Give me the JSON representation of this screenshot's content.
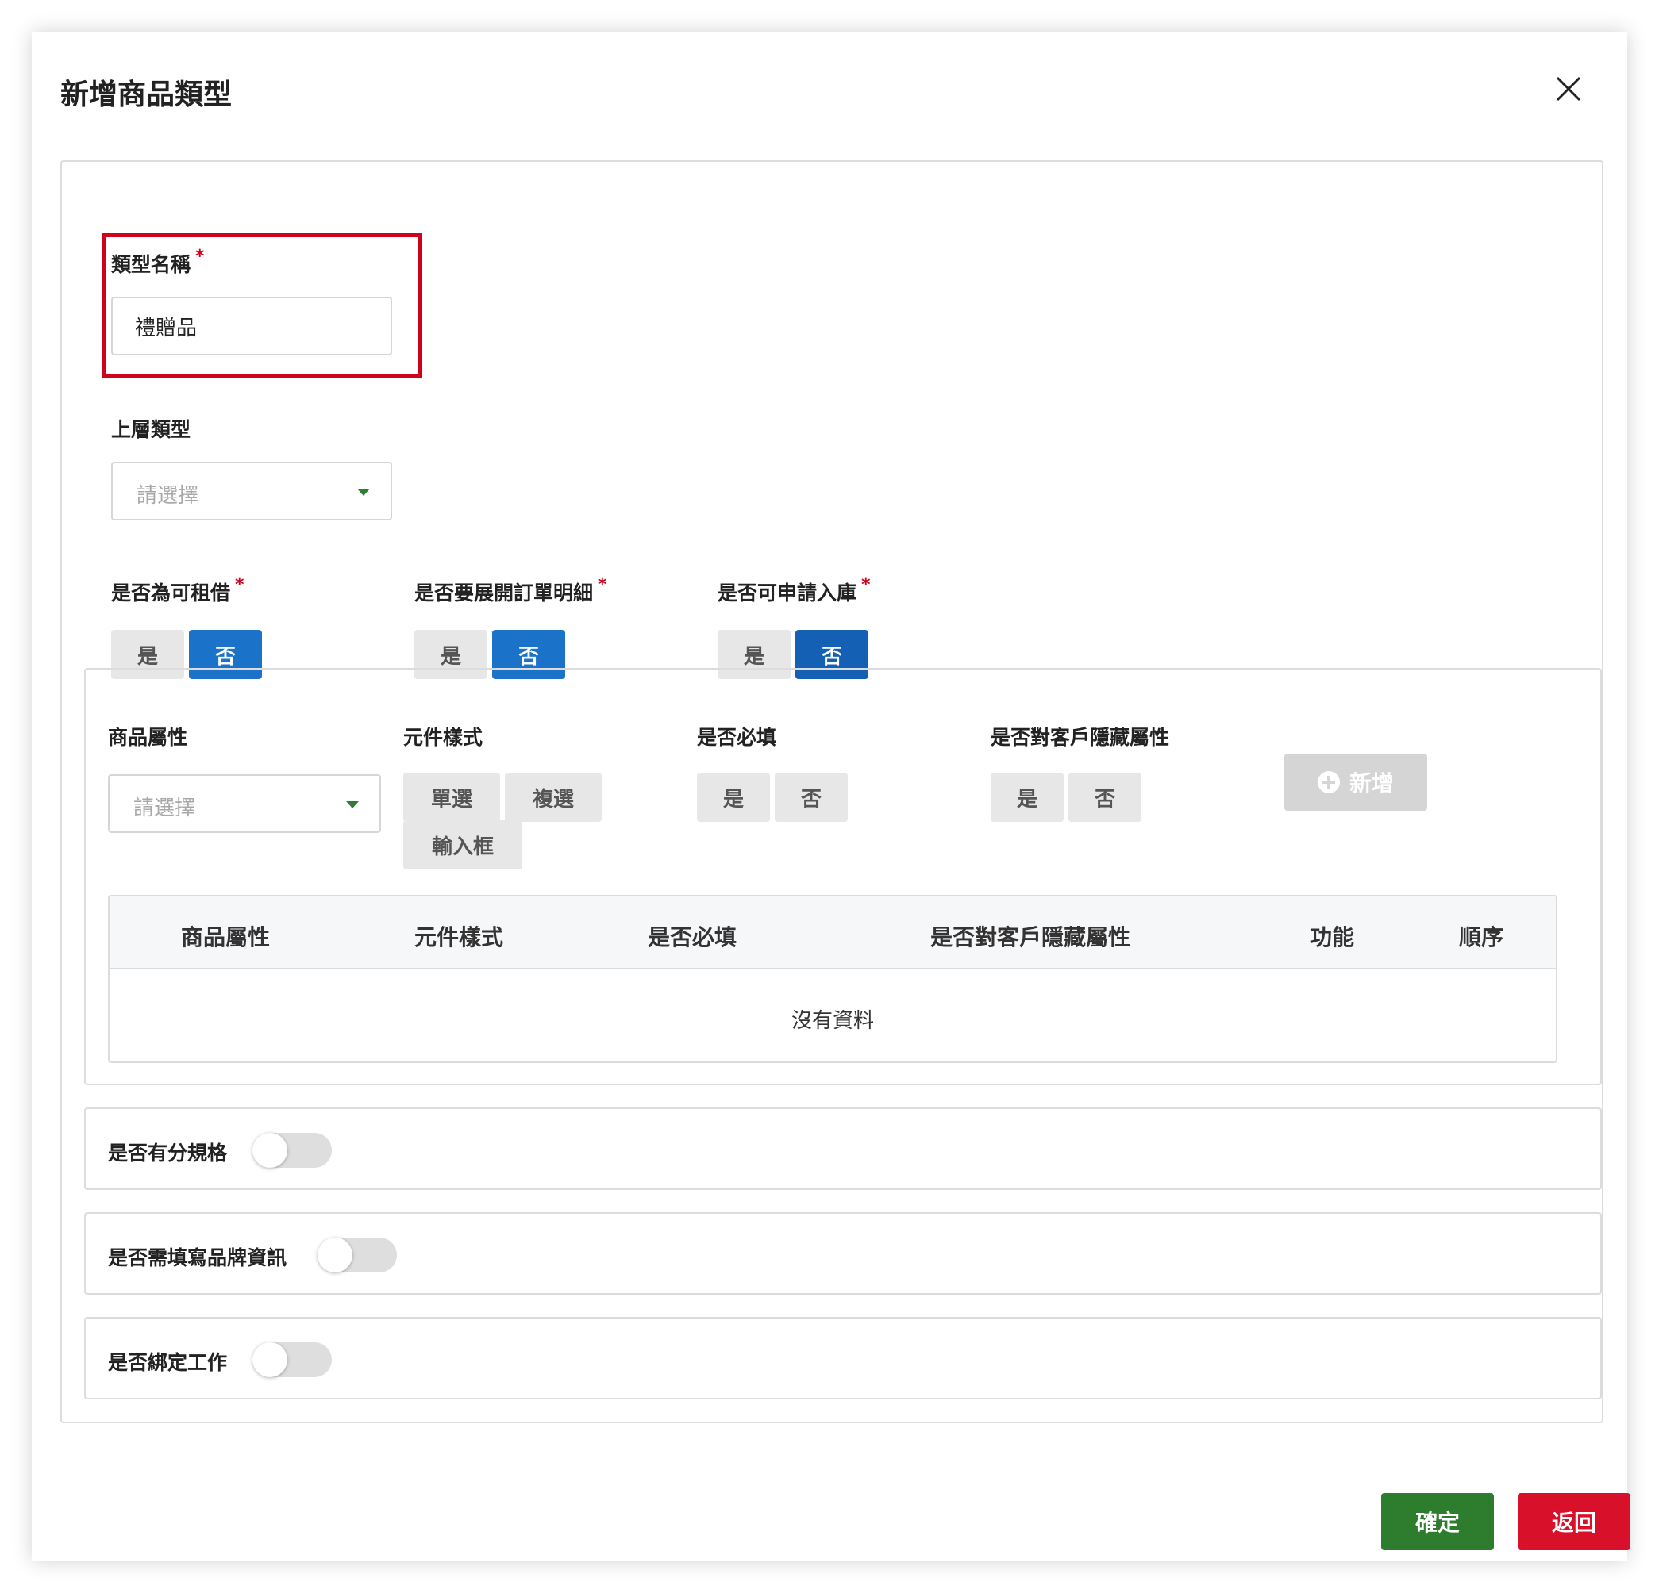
{
  "modal": {
    "title": "新增商品類型"
  },
  "type_name": {
    "label": "類型名稱",
    "required_mark": "*",
    "value": "禮贈品"
  },
  "parent_type": {
    "label": "上層類型",
    "placeholder": "請選擇"
  },
  "rentable": {
    "label": "是否為可租借",
    "required_mark": "*",
    "options": [
      "是",
      "否"
    ],
    "selected": "否"
  },
  "expand_order_detail": {
    "label": "是否要展開訂單明細",
    "required_mark": "*",
    "options": [
      "是",
      "否"
    ],
    "selected": "否"
  },
  "apply_stock_in": {
    "label": "是否可申請入庫",
    "required_mark": "*",
    "options": [
      "是",
      "否"
    ],
    "selected": "否"
  },
  "attributes": {
    "attr_label": "商品屬性",
    "attr_placeholder": "請選擇",
    "component_label": "元件樣式",
    "component_options": [
      "單選",
      "複選",
      "輸入框"
    ],
    "required_label": "是否必填",
    "required_options": [
      "是",
      "否"
    ],
    "hidden_label": "是否對客戶隱藏屬性",
    "hidden_options": [
      "是",
      "否"
    ],
    "add_button": "新增",
    "table": {
      "columns": [
        "商品屬性",
        "元件樣式",
        "是否必填",
        "是否對客戶隱藏屬性",
        "功能",
        "順序"
      ],
      "empty_text": "沒有資料"
    }
  },
  "toggles": [
    {
      "label": "是否有分規格",
      "on": false
    },
    {
      "label": "是否需填寫品牌資訊",
      "on": false
    },
    {
      "label": "是否綁定工作",
      "on": false
    }
  ],
  "footer": {
    "confirm": "確定",
    "back": "返回"
  },
  "colors": {
    "selected_blue": "#1a73c9",
    "required_red": "#d0021b",
    "confirm_green": "#2e7d2e",
    "back_red": "#d8102a"
  }
}
